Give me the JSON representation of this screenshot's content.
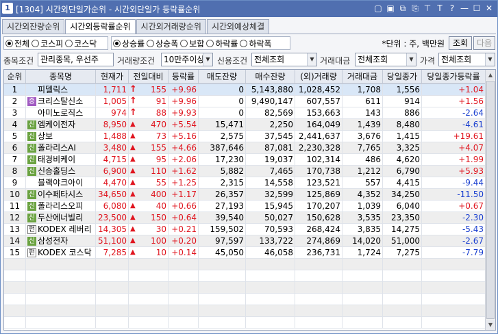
{
  "window": {
    "number": "1",
    "title": "[1304] 시간외단일가순위 - 시간외단일가 등락률순위",
    "icons": [
      "window-icon",
      "memo-icon",
      "link-icon",
      "copy-icon",
      "pin-icon",
      "font-icon",
      "help-icon",
      "minimize-icon",
      "maximize-icon",
      "close-icon"
    ],
    "icon_glyphs": [
      "▢",
      "▣",
      "⧉",
      "⎘",
      "⊤",
      "T",
      "?",
      "—",
      "☐",
      "✕"
    ]
  },
  "tabs": [
    {
      "label": "시간외잔량순위",
      "active": false
    },
    {
      "label": "시간외등락률순위",
      "active": true
    },
    {
      "label": "시간외거래량순위",
      "active": false
    },
    {
      "label": "시간외예상체결",
      "active": false
    }
  ],
  "market_radios": [
    {
      "label": "전체",
      "checked": true
    },
    {
      "label": "코스피",
      "checked": false
    },
    {
      "label": "코스닥",
      "checked": false
    }
  ],
  "rank_radios": [
    {
      "label": "상승률",
      "checked": true
    },
    {
      "label": "상승폭",
      "checked": false
    },
    {
      "label": "보합",
      "checked": false
    },
    {
      "label": "하락률",
      "checked": false
    },
    {
      "label": "하락폭",
      "checked": false
    }
  ],
  "unit_text": "*단위 : 주, 백만원",
  "buttons": {
    "query": "조회",
    "next": "다음"
  },
  "filters": {
    "stock_cond_label": "종목조건",
    "stock_cond_value": "관리종목, 우선주",
    "volume_cond_label": "거래량조건",
    "volume_cond_value": "10만주이상",
    "credit_cond_label": "신용조건",
    "credit_cond_value": "전체조회",
    "amount_label": "거래대금",
    "amount_value": "전체조회",
    "price_label": "가격",
    "price_value": "전체조회"
  },
  "columns": [
    "순위",
    "종목명",
    "현재가",
    "전일대비",
    "등락률",
    "매도잔량",
    "매수잔량",
    "(외)거래량",
    "거래대금",
    "당일종가",
    "당일종가등락률"
  ],
  "rows": [
    {
      "rank": "1",
      "badge": "",
      "name": "피델릭스",
      "price": "1,711",
      "dir": "upper",
      "change": "155",
      "rate": "+9.96",
      "ask": "0",
      "bid": "5,143,880",
      "volume": "1,028,452",
      "amount": "1,708",
      "close": "1,556",
      "close_rate": "+1.04",
      "close_dir": "up"
    },
    {
      "rank": "2",
      "badge": "증",
      "name": "크리스탈신소",
      "price": "1,005",
      "dir": "upper",
      "change": "91",
      "rate": "+9.96",
      "ask": "0",
      "bid": "9,490,147",
      "volume": "607,557",
      "amount": "611",
      "close": "914",
      "close_rate": "+1.56",
      "close_dir": "up"
    },
    {
      "rank": "3",
      "badge": "",
      "name": "아미노로직스",
      "price": "974",
      "dir": "upper",
      "change": "88",
      "rate": "+9.93",
      "ask": "0",
      "bid": "82,569",
      "volume": "153,663",
      "amount": "143",
      "close": "886",
      "close_rate": "-2.64",
      "close_dir": "down"
    },
    {
      "rank": "4",
      "badge": "신",
      "name": "엠케이전자",
      "price": "8,950",
      "dir": "up",
      "change": "470",
      "rate": "+5.54",
      "ask": "15,471",
      "bid": "2,250",
      "volume": "164,049",
      "amount": "1,439",
      "close": "8,480",
      "close_rate": "-4.61",
      "close_dir": "down"
    },
    {
      "rank": "5",
      "badge": "신",
      "name": "상보",
      "price": "1,488",
      "dir": "up",
      "change": "73",
      "rate": "+5.16",
      "ask": "2,575",
      "bid": "37,545",
      "volume": "2,441,637",
      "amount": "3,676",
      "close": "1,415",
      "close_rate": "+19.61",
      "close_dir": "up"
    },
    {
      "rank": "6",
      "badge": "신",
      "name": "폴라리스AI",
      "price": "3,480",
      "dir": "up",
      "change": "155",
      "rate": "+4.66",
      "ask": "387,646",
      "bid": "87,081",
      "volume": "2,230,328",
      "amount": "7,765",
      "close": "3,325",
      "close_rate": "+4.07",
      "close_dir": "up"
    },
    {
      "rank": "7",
      "badge": "신",
      "name": "태경비케이",
      "price": "4,715",
      "dir": "up",
      "change": "95",
      "rate": "+2.06",
      "ask": "17,230",
      "bid": "19,037",
      "volume": "102,314",
      "amount": "486",
      "close": "4,620",
      "close_rate": "+1.99",
      "close_dir": "up"
    },
    {
      "rank": "8",
      "badge": "신",
      "name": "신송홀딩스",
      "price": "6,900",
      "dir": "up",
      "change": "110",
      "rate": "+1.62",
      "ask": "5,882",
      "bid": "7,465",
      "volume": "170,738",
      "amount": "1,212",
      "close": "6,790",
      "close_rate": "+5.93",
      "close_dir": "up"
    },
    {
      "rank": "9",
      "badge": "",
      "name": "블랙야크아이",
      "price": "4,470",
      "dir": "up",
      "change": "55",
      "rate": "+1.25",
      "ask": "2,315",
      "bid": "14,558",
      "volume": "123,521",
      "amount": "557",
      "close": "4,415",
      "close_rate": "-9.44",
      "close_dir": "down"
    },
    {
      "rank": "10",
      "badge": "신",
      "name": "이수페타시스",
      "price": "34,650",
      "dir": "up",
      "change": "400",
      "rate": "+1.17",
      "ask": "26,357",
      "bid": "32,599",
      "volume": "125,869",
      "amount": "4,352",
      "close": "34,250",
      "close_rate": "-11.50",
      "close_dir": "down"
    },
    {
      "rank": "11",
      "badge": "신",
      "name": "폴라리스오피",
      "price": "6,080",
      "dir": "up",
      "change": "40",
      "rate": "+0.66",
      "ask": "27,193",
      "bid": "15,945",
      "volume": "170,207",
      "amount": "1,039",
      "close": "6,040",
      "close_rate": "+0.67",
      "close_dir": "up"
    },
    {
      "rank": "12",
      "badge": "신",
      "name": "두산에너빌리",
      "price": "23,500",
      "dir": "up",
      "change": "150",
      "rate": "+0.64",
      "ask": "39,540",
      "bid": "50,027",
      "volume": "150,628",
      "amount": "3,535",
      "close": "23,350",
      "close_rate": "-2.30",
      "close_dir": "down"
    },
    {
      "rank": "13",
      "badge": "펀",
      "name": "KODEX 레버리",
      "price": "14,305",
      "dir": "up",
      "change": "30",
      "rate": "+0.21",
      "ask": "159,502",
      "bid": "70,593",
      "volume": "268,424",
      "amount": "3,835",
      "close": "14,275",
      "close_rate": "-5.43",
      "close_dir": "down"
    },
    {
      "rank": "14",
      "badge": "신",
      "name": "삼성전자",
      "price": "51,100",
      "dir": "up",
      "change": "100",
      "rate": "+0.20",
      "ask": "97,597",
      "bid": "133,722",
      "volume": "274,869",
      "amount": "14,020",
      "close": "51,000",
      "close_rate": "-2.67",
      "close_dir": "down"
    },
    {
      "rank": "15",
      "badge": "펀",
      "name": "KODEX 코스닥",
      "price": "7,285",
      "dir": "up",
      "change": "10",
      "rate": "+0.14",
      "ask": "45,050",
      "bid": "46,058",
      "volume": "236,731",
      "amount": "1,724",
      "close": "7,275",
      "close_rate": "-7.79",
      "close_dir": "down"
    }
  ],
  "colors": {
    "up": "#e0141e",
    "down": "#1a3fd0",
    "title_bar": "#506fb0",
    "selected_row": "#d9e7f7",
    "badge_green": "#6aa240",
    "badge_purple": "#a15bc2"
  }
}
